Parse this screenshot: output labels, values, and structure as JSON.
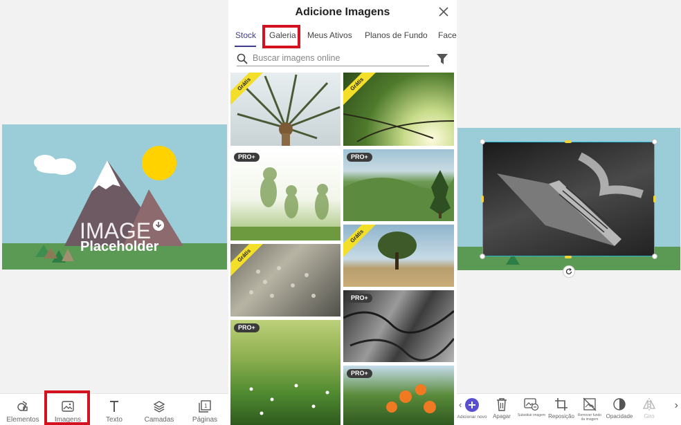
{
  "left_toolbar": {
    "items": [
      {
        "label": "Elementos",
        "icon": "elements-icon"
      },
      {
        "label": "Imagens",
        "icon": "image-icon"
      },
      {
        "label": "Texto",
        "icon": "text-icon"
      },
      {
        "label": "Camadas",
        "icon": "layers-icon"
      },
      {
        "label": "Páginas",
        "icon": "pages-icon"
      }
    ],
    "highlighted": "Imagens"
  },
  "placeholder": {
    "line1": "IMAGE",
    "line2": "Placeholder"
  },
  "dialog": {
    "title": "Adicione Imagens",
    "tabs": [
      "Stock",
      "Galeria",
      "Meus Ativos",
      "Planos de Fundo",
      "Facel"
    ],
    "active_tab": "Stock",
    "highlighted_tab": "Galeria",
    "search_placeholder": "Buscar imagens online",
    "badges": {
      "free": "Grátis",
      "pro": "PRO+"
    },
    "images": [
      {
        "subject": "palm tree from below",
        "badge": "free"
      },
      {
        "subject": "tree canopy with sun",
        "badge": "free"
      },
      {
        "subject": "children jumping double exposure",
        "badge": "pro"
      },
      {
        "subject": "green hills with tree",
        "badge": "pro"
      },
      {
        "subject": "frosted plants",
        "badge": "free"
      },
      {
        "subject": "lone tree in field",
        "badge": "free"
      },
      {
        "subject": "meadow with flowers",
        "badge": "pro"
      },
      {
        "subject": "cracked rock texture",
        "badge": "pro"
      },
      {
        "subject": "orange flowers",
        "badge": "pro"
      }
    ]
  },
  "right_toolbar": {
    "items": [
      {
        "label": "Adicionar novo",
        "icon": "add-new-icon"
      },
      {
        "label": "Apagar",
        "icon": "trash-icon"
      },
      {
        "label": "Substituir imagem",
        "icon": "replace-image-icon"
      },
      {
        "label": "Reposição",
        "icon": "crop-icon"
      },
      {
        "label": "Remover fundo da imagem",
        "icon": "remove-background-icon"
      },
      {
        "label": "Opacidade",
        "icon": "opacity-icon"
      },
      {
        "label": "Giro",
        "icon": "flip-icon"
      }
    ]
  },
  "colors": {
    "highlight": "#d4111f",
    "accent": "#3e3a8f",
    "sky": "#9bcdd8",
    "grass": "#5b9a55",
    "sun": "#ffd200",
    "badge_free": "#f3df2a",
    "selection": "#2ab3d0"
  }
}
